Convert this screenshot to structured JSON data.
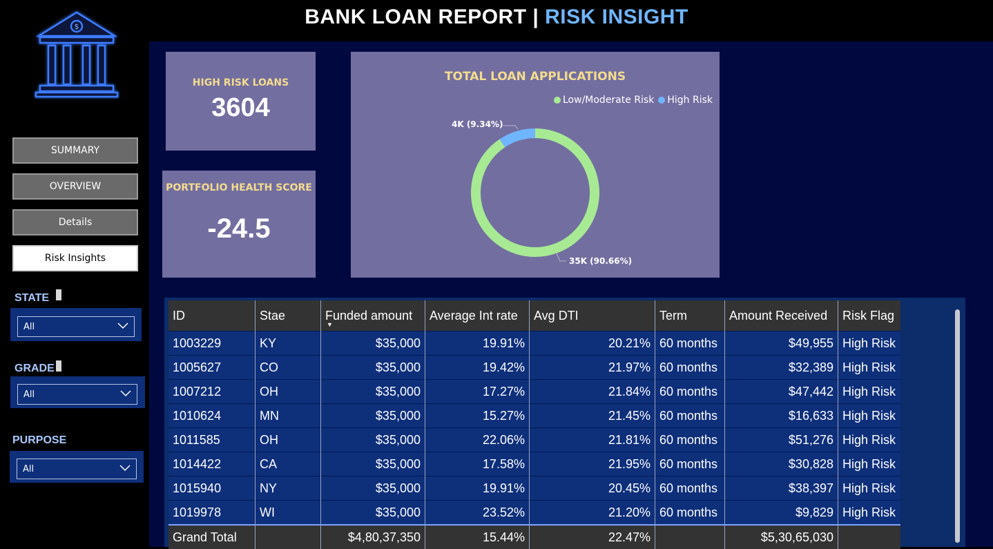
{
  "header": {
    "title_main": "BANK LOAN REPORT | ",
    "title_accent": "RISK INSIGHT",
    "accent_color": "#6fb6ff"
  },
  "nav": {
    "summary": "SUMMARY",
    "overview": "OVERVIEW",
    "details": "Details",
    "risk_insights": "Risk Insights",
    "active": "Risk Insights"
  },
  "filters": {
    "state": {
      "label": "STATE",
      "value": "All"
    },
    "grade": {
      "label": "GRADE",
      "value": "All"
    },
    "purpose": {
      "label": "PURPOSE",
      "value": "All"
    }
  },
  "kpis": {
    "high_risk": {
      "label": "HIGH RISK LOANS",
      "value": "3604"
    },
    "health": {
      "label": "PORTFOLIO HEALTH SCORE",
      "value": "-24.5"
    }
  },
  "chart_data": {
    "type": "pie",
    "title": "TOTAL LOAN APPLICATIONS",
    "legend_position": "top-right",
    "series": [
      {
        "name": "Low/Moderate Risk",
        "value": 35000,
        "percent": 90.66,
        "label": "35K (90.66%)",
        "color": "#a7ea93"
      },
      {
        "name": "High Risk",
        "value": 4000,
        "percent": 9.34,
        "label": "4K (9.34%)",
        "color": "#6fb6ff"
      }
    ]
  },
  "table": {
    "columns": [
      "ID",
      "Stae",
      "Funded amount",
      "Average Int rate",
      "Avg DTI",
      "Term",
      "Amount Received",
      "Risk Flag"
    ],
    "rows": [
      [
        "1003229",
        "KY",
        "$35,000",
        "19.91%",
        "20.21%",
        "60 months",
        "$49,955",
        "High Risk"
      ],
      [
        "1005627",
        "CO",
        "$35,000",
        "19.42%",
        "21.97%",
        "60 months",
        "$32,389",
        "High Risk"
      ],
      [
        "1007212",
        "OH",
        "$35,000",
        "17.27%",
        "21.84%",
        "60 months",
        "$47,442",
        "High Risk"
      ],
      [
        "1010624",
        "MN",
        "$35,000",
        "15.27%",
        "21.45%",
        "60 months",
        "$16,633",
        "High Risk"
      ],
      [
        "1011585",
        "OH",
        "$35,000",
        "22.06%",
        "21.81%",
        "60 months",
        "$51,276",
        "High Risk"
      ],
      [
        "1014422",
        "CA",
        "$35,000",
        "17.58%",
        "21.95%",
        "60 months",
        "$30,828",
        "High Risk"
      ],
      [
        "1015940",
        "NY",
        "$35,000",
        "19.91%",
        "20.45%",
        "60 months",
        "$38,397",
        "High Risk"
      ],
      [
        "1019978",
        "WI",
        "$35,000",
        "23.52%",
        "21.20%",
        "60 months",
        "$9,829",
        "High Risk"
      ]
    ],
    "total": [
      "Grand Total",
      "",
      "$4,80,37,350",
      "15.44%",
      "22.47%",
      "",
      "$5,30,65,030",
      ""
    ]
  }
}
